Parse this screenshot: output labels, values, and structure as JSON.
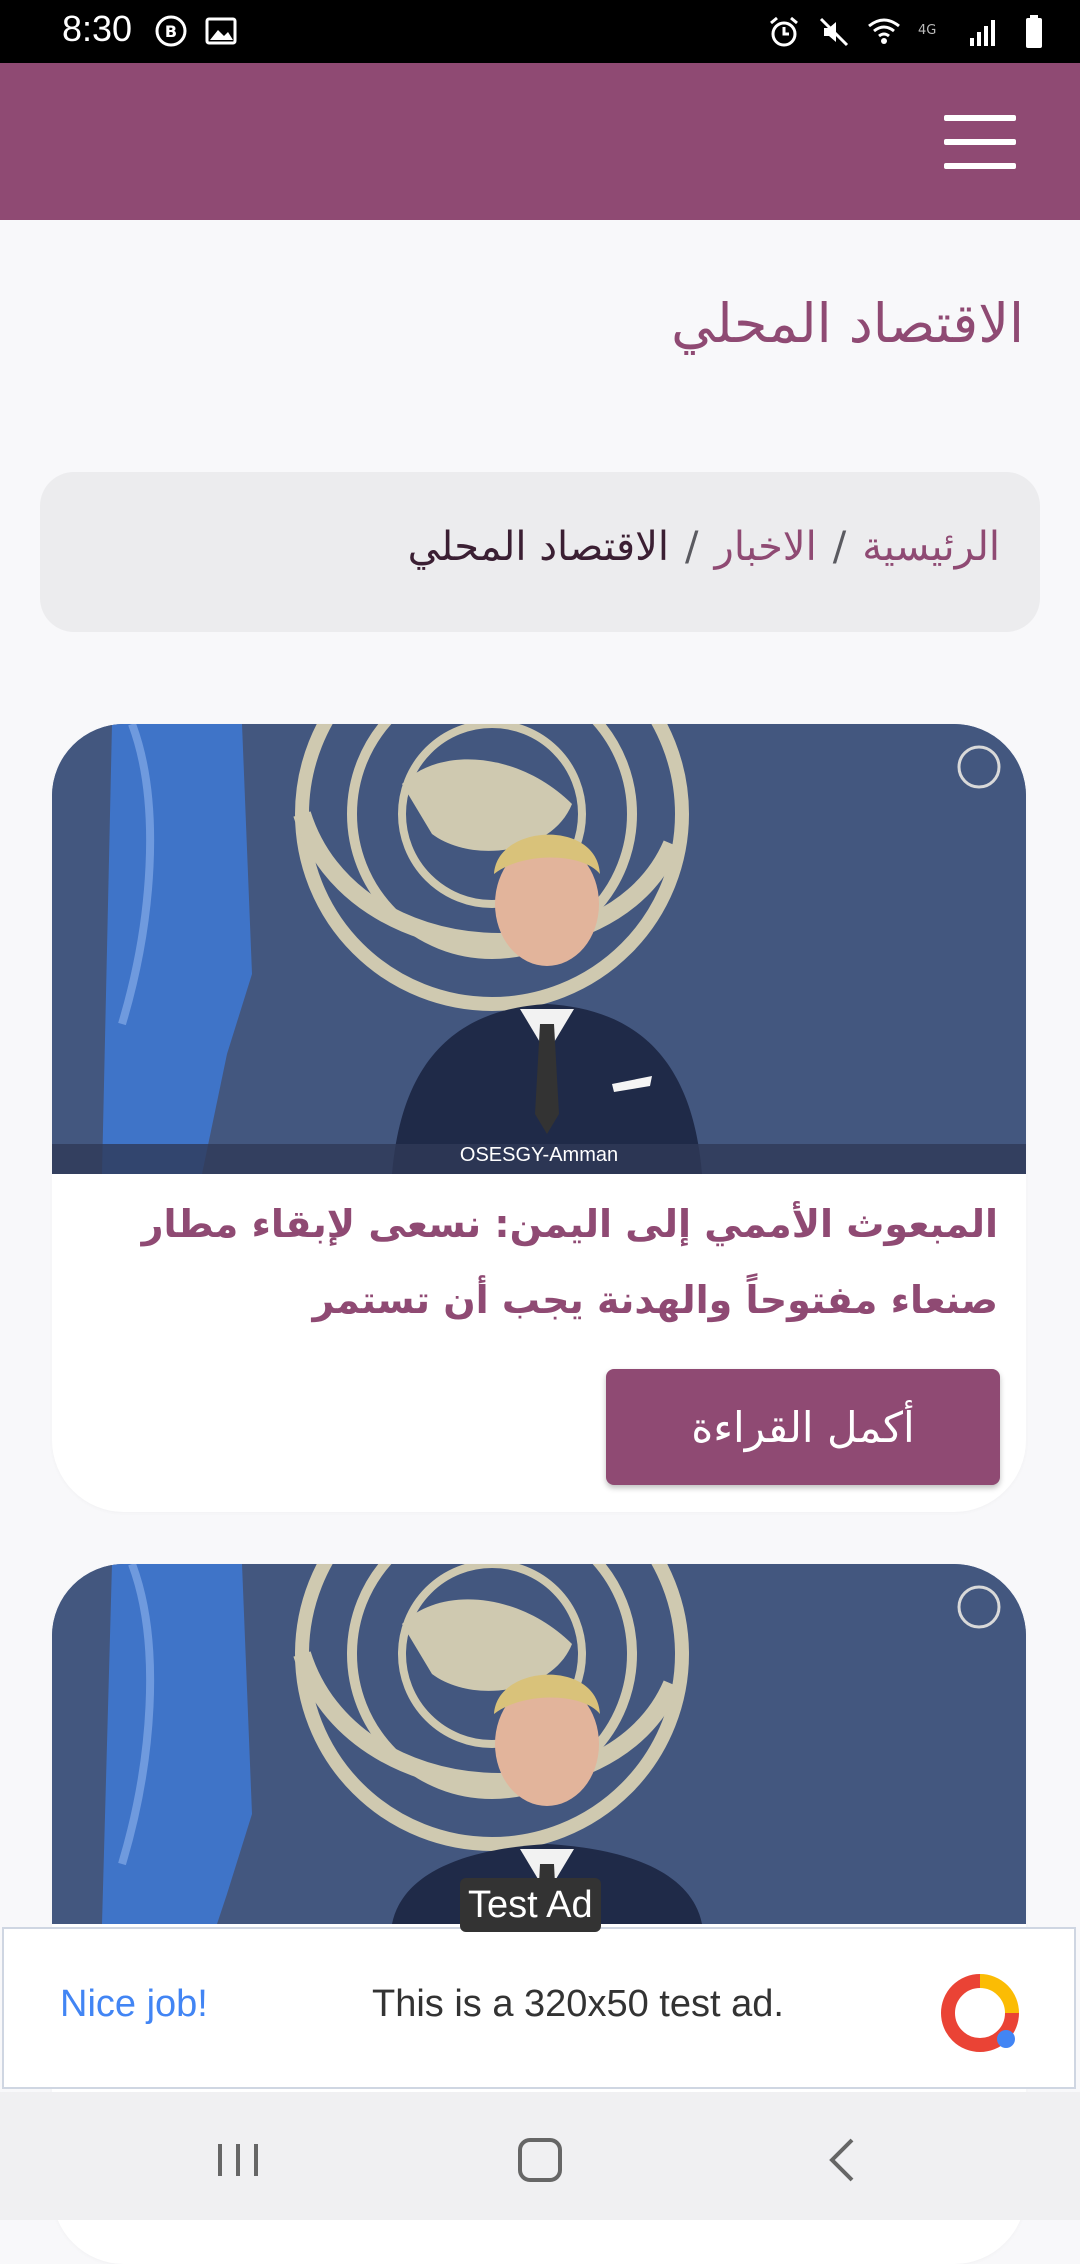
{
  "status_bar": {
    "time": "8:30"
  },
  "header": {
    "menu_icon": "hamburger-menu-icon"
  },
  "page": {
    "title": "الاقتصاد المحلي"
  },
  "breadcrumb": {
    "items": [
      "الرئيسية",
      "الاخبار"
    ],
    "separator": "/",
    "current": "الاقتصاد المحلي"
  },
  "articles": [
    {
      "image_caption": "OSESGY-Amman",
      "title": "المبعوث الأممي إلى اليمن: نسعى لإبقاء مطار صنعاء مفتوحاً والهدنة يجب أن تستمر",
      "read_more": "أكمل القراءة"
    },
    {
      "image_caption": "",
      "title": "",
      "read_more": ""
    }
  ],
  "ad": {
    "tag": "Test Ad",
    "headline": "Nice job!",
    "text": "This is a 320x50 test ad."
  },
  "colors": {
    "brand": "#8f4a73",
    "background": "#f8f8fa",
    "breadcrumb_bg": "#ececee"
  }
}
